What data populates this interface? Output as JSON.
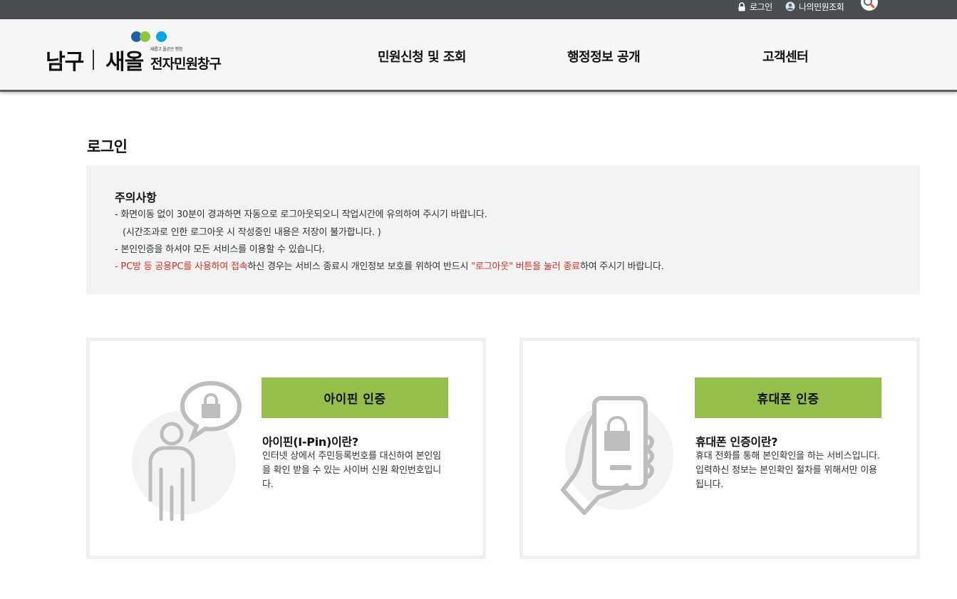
{
  "topbar": {
    "login_label": "로그인",
    "my_requests_label": "나의민원조회",
    "search_icon": "search-icon"
  },
  "header": {
    "logo": {
      "district": "남구",
      "brand": "새올",
      "slogan": "새롭고 올곧은 행정",
      "subtitle": "전자민원창구",
      "dot_colors": [
        "#1f5fa8",
        "#8dc63f",
        "#00a7e6"
      ]
    },
    "nav": [
      {
        "label": "민원신청 및 조회"
      },
      {
        "label": "행정정보 공개"
      },
      {
        "label": "고객센터"
      }
    ]
  },
  "main": {
    "title": "로그인",
    "notice": {
      "title": "주의사항",
      "line1": "- 화면이동 없이 30분이 경과하면 자동으로 로그아웃되오니 작업시간에 유의하여 주시기 바랍니다.",
      "line2": "(시간조과로 인한 로그아웃 시 작성중인 내용은 저장이 불가합니다. )",
      "line3": "- 본인인증을 하셔야 모든 서비스를 이용할 수 있습니다.",
      "line4": {
        "part1": "- PC방 등 공용PC를 사용하여 접속",
        "part2": "하신 경우는 서비스 종료시 개인정보 보호를 위하여 반드시 ",
        "part3": "\"로그아웃\" 버튼을 눌러 종료",
        "part4": "하여 주시기 바랍니다."
      }
    },
    "cards": [
      {
        "button_label": "아이핀 인증",
        "desc_title": "아이핀(I-Pin)이란?",
        "desc_text": "인터넷 상에서 주민등록번호를 대신하여 본인임을 확인 받을 수 있는 사이버 신원 확인번호입니다.",
        "icon": "person-lock-icon"
      },
      {
        "button_label": "휴대폰 인증",
        "desc_title": "휴대폰 인증이란?",
        "desc_text": "휴대 전화를 통해 본인확인을 하는 서비스입니다. 입력하신 정보는 본인확인 절차를 위해서만 이용됩니다.",
        "icon": "phone-lock-icon"
      }
    ]
  },
  "colors": {
    "topbar_bg": "#4a4d52",
    "accent_green": "#95bf4a",
    "warning_red": "#d9302a",
    "icon_gray": "#bdbdbd"
  }
}
